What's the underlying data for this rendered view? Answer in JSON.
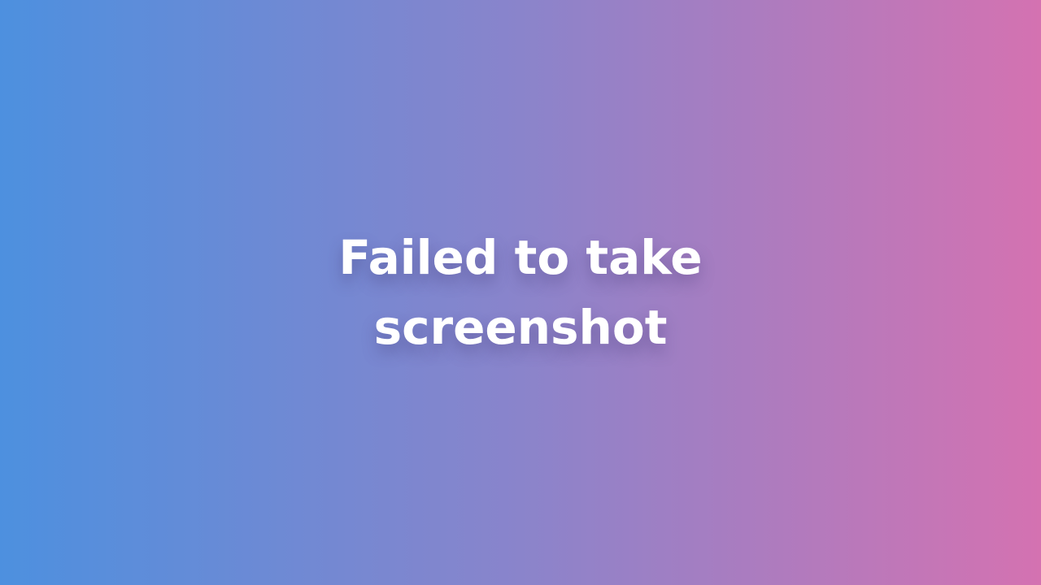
{
  "screen": {
    "background_gradient": [
      "#4d90df",
      "#8a84cb",
      "#d472b1"
    ],
    "text_color": "#ffffff",
    "message": {
      "line1": "Failed to take",
      "line2": "screenshot"
    }
  }
}
